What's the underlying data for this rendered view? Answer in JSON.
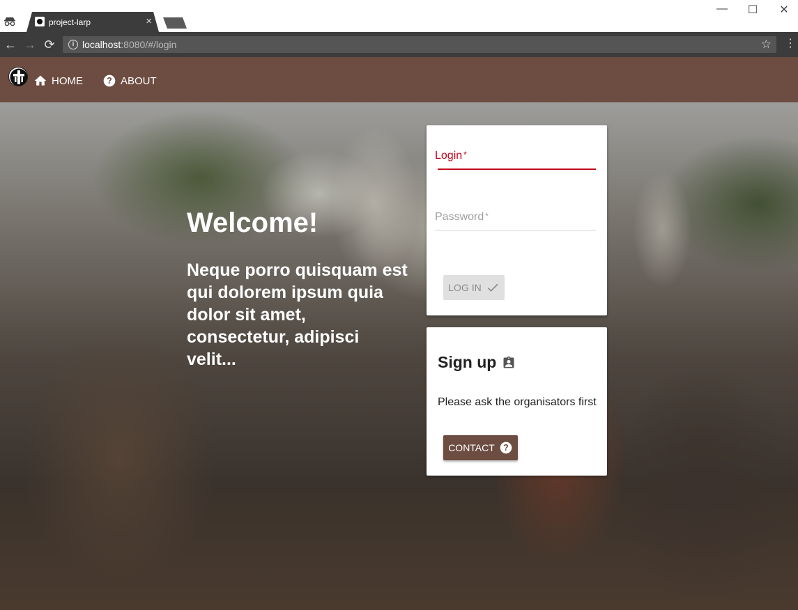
{
  "browser": {
    "tab_title": "project-larp",
    "tab_close": "×",
    "url_host": "localhost",
    "url_rest": ":8080/#/login",
    "window_controls": {
      "minimize": "—",
      "maximize": "☐",
      "close": "✕"
    },
    "nav": {
      "back": "←",
      "forward": "→",
      "reload": "⟳"
    },
    "star": "☆",
    "menu": "⋮",
    "info": "i"
  },
  "header": {
    "logo_icon": "shield-cross-icon",
    "nav": [
      {
        "label": "HOME",
        "icon": "home-icon"
      },
      {
        "label": "ABOUT",
        "icon": "help-circle-icon"
      }
    ]
  },
  "hero": {
    "title": "Welcome!",
    "tagline": "Neque porro quisquam est qui dolorem ipsum quia dolor sit amet, consectetur, adipisci velit..."
  },
  "login": {
    "login_label": "Login",
    "password_label": "Password",
    "required_mark": "*",
    "button_label": "LOG IN",
    "button_icon": "check-icon"
  },
  "signup": {
    "title": "Sign up",
    "title_icon": "clipboard-account-icon",
    "text": "Please ask the organisators first",
    "button_label": "CONTACT",
    "button_icon": "help-circle-icon"
  },
  "colors": {
    "brand": "#6d4c41",
    "error": "#c10015",
    "button_disabled": "#e0e0e0"
  }
}
